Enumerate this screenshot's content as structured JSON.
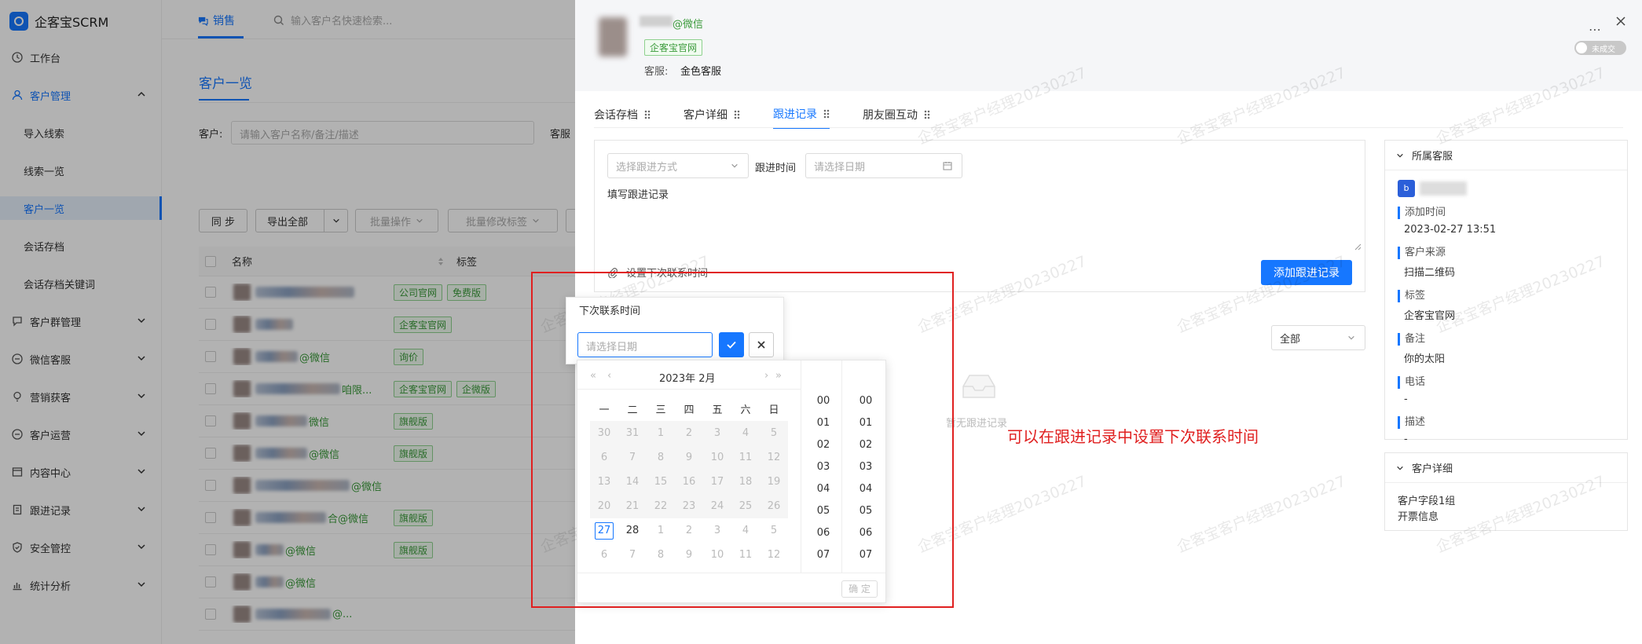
{
  "app": {
    "title": "企客宝SCRM"
  },
  "topbar": {
    "module_tab": "销售",
    "search_placeholder": "输入客户名快速检索..."
  },
  "sidebar": {
    "items": [
      {
        "label": "工作台",
        "icon": "clock-icon"
      },
      {
        "label": "客户管理",
        "icon": "user-icon"
      },
      {
        "label": "导入线索"
      },
      {
        "label": "线索一览"
      },
      {
        "label": "客户一览"
      },
      {
        "label": "会话存档"
      },
      {
        "label": "会话存档关键词"
      },
      {
        "label": "客户群管理",
        "icon": "chat-icon"
      },
      {
        "label": "微信客服",
        "icon": "headset-icon"
      },
      {
        "label": "营销获客",
        "icon": "bulb-icon"
      },
      {
        "label": "客户运营",
        "icon": "ops-icon"
      },
      {
        "label": "内容中心",
        "icon": "content-icon"
      },
      {
        "label": "跟进记录",
        "icon": "record-icon"
      },
      {
        "label": "安全管控",
        "icon": "shield-icon"
      },
      {
        "label": "统计分析",
        "icon": "chart-icon"
      }
    ]
  },
  "page": {
    "title": "客户一览",
    "filter_label": "客户:",
    "filter_placeholder": "请输入客户名称/备注/描述",
    "filter_label2": "客服",
    "buttons": {
      "sync": "同 步",
      "export": "导出全部",
      "batch": "批量操作",
      "batch_tag": "批量修改标签"
    },
    "table_headers": {
      "name": "名称",
      "tag": "标签"
    },
    "rows": [
      {
        "suffix": "",
        "tags": [
          "公司官网",
          "免费版"
        ]
      },
      {
        "suffix": "",
        "tags": [
          "企客宝官网"
        ]
      },
      {
        "suffix": "@微信",
        "tags": [
          "询价"
        ]
      },
      {
        "suffix": "咱限...",
        "tags": [
          "企客宝官网",
          "企微版"
        ]
      },
      {
        "suffix": "微信",
        "tags": [
          "旗舰版"
        ]
      },
      {
        "suffix": "@微信",
        "tags": [
          "旗舰版"
        ]
      },
      {
        "suffix": "@微信",
        "tags": []
      },
      {
        "suffix": "合@微信",
        "tags": [
          "旗舰版"
        ]
      },
      {
        "suffix": "@微信",
        "tags": [
          "旗舰版"
        ]
      },
      {
        "suffix": "@微信",
        "tags": []
      },
      {
        "suffix": "@...",
        "tags": []
      }
    ]
  },
  "drawer": {
    "customer": {
      "source": "@微信",
      "tag": "企客宝官网",
      "service_label": "客服:",
      "service_name": "金色客服"
    },
    "deal_status": "未成交",
    "tabs": [
      "会话存档",
      "客户详细",
      "跟进记录",
      "朋友圈互动"
    ],
    "active_tab": 2,
    "followup": {
      "method_placeholder": "选择跟进方式",
      "time_label": "跟进时间",
      "date_placeholder": "请选择日期",
      "record_placeholder": "填写跟进记录",
      "next_contact_link": "设置下次联系时间",
      "add_button": "添加跟进记录"
    },
    "filter_all": "全部",
    "empty_text": "暂无跟进记录",
    "side_panel": {
      "title": "所属客服",
      "fields": [
        {
          "label": "添加时间",
          "value": "2023-02-27 13:51"
        },
        {
          "label": "客户来源",
          "value": "扫描二维码"
        },
        {
          "label": "标签",
          "value": "企客宝官网"
        },
        {
          "label": "备注",
          "value": "你的太阳"
        },
        {
          "label": "电话",
          "value": "-"
        },
        {
          "label": "描述",
          "value": "-"
        }
      ]
    },
    "detail_panel": {
      "title": "客户详细",
      "lines": [
        "客户字段1组",
        "开票信息"
      ]
    }
  },
  "popover": {
    "title": "下次联系时间",
    "date_placeholder": "请选择日期",
    "calendar": {
      "header": "2023年  2月",
      "weekdays": [
        "一",
        "二",
        "三",
        "四",
        "五",
        "六",
        "日"
      ],
      "weeks": [
        [
          "30",
          "31",
          "1",
          "2",
          "3",
          "4",
          "5"
        ],
        [
          "6",
          "7",
          "8",
          "9",
          "10",
          "11",
          "12"
        ],
        [
          "13",
          "14",
          "15",
          "16",
          "17",
          "18",
          "19"
        ],
        [
          "20",
          "21",
          "22",
          "23",
          "24",
          "25",
          "26"
        ],
        [
          "27",
          "28",
          "1",
          "2",
          "3",
          "4",
          "5"
        ],
        [
          "6",
          "7",
          "8",
          "9",
          "10",
          "11",
          "12"
        ]
      ],
      "today": "27",
      "hours": [
        "00",
        "01",
        "02",
        "03",
        "04",
        "05",
        "06",
        "07"
      ],
      "minutes": [
        "00",
        "01",
        "02",
        "03",
        "04",
        "05",
        "06",
        "07"
      ],
      "confirm": "确 定"
    }
  },
  "annotation": "可以在跟进记录中设置下次联系时间",
  "watermark": "企客宝客户经理20230227",
  "colors": {
    "accent": "#1677ff",
    "annotation": "#e02020",
    "tag_green": "#3a9a3a"
  }
}
